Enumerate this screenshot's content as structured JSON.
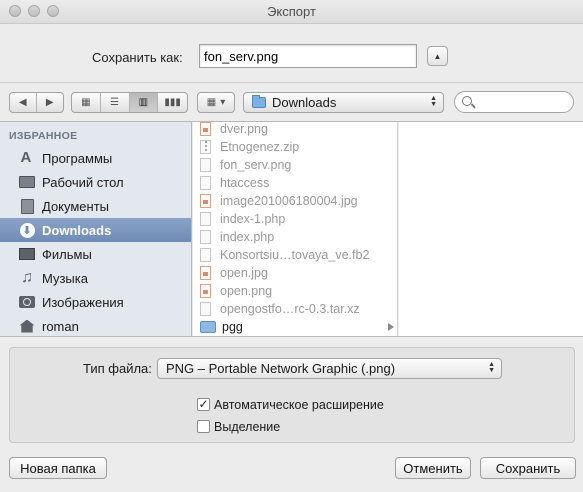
{
  "window": {
    "title": "Экспорт"
  },
  "save_as": {
    "label": "Сохранить как:",
    "value": "fon_serv.png"
  },
  "toolbar": {
    "location": "Downloads",
    "search_placeholder": ""
  },
  "sidebar": {
    "header": "ИЗБРАННОЕ",
    "items": [
      {
        "label": "Программы",
        "icon": "applications-icon",
        "selected": false
      },
      {
        "label": "Рабочий стол",
        "icon": "desktop-icon",
        "selected": false
      },
      {
        "label": "Документы",
        "icon": "documents-icon",
        "selected": false
      },
      {
        "label": "Downloads",
        "icon": "downloads-icon",
        "selected": true
      },
      {
        "label": "Фильмы",
        "icon": "movies-icon",
        "selected": false
      },
      {
        "label": "Музыка",
        "icon": "music-icon",
        "selected": false
      },
      {
        "label": "Изображения",
        "icon": "pictures-icon",
        "selected": false
      },
      {
        "label": "roman",
        "icon": "home-icon",
        "selected": false
      }
    ]
  },
  "files": [
    {
      "name": "dver.png",
      "kind": "img"
    },
    {
      "name": "Etnogenez.zip",
      "kind": "zip"
    },
    {
      "name": "fon_serv.png",
      "kind": "doc"
    },
    {
      "name": "htaccess",
      "kind": "doc"
    },
    {
      "name": "image201006180004.jpg",
      "kind": "img"
    },
    {
      "name": "index-1.php",
      "kind": "doc"
    },
    {
      "name": "index.php",
      "kind": "doc"
    },
    {
      "name": "Konsortsiu…tovaya_ve.fb2",
      "kind": "doc"
    },
    {
      "name": "open.jpg",
      "kind": "img"
    },
    {
      "name": "open.png",
      "kind": "img"
    },
    {
      "name": "opengostfo…rc-0.3.tar.xz",
      "kind": "doc"
    },
    {
      "name": "pgg",
      "kind": "folder"
    }
  ],
  "options": {
    "file_type_label": "Тип файла:",
    "file_type_value": "PNG – Portable Network Graphic (.png)",
    "auto_extension": {
      "label": "Автоматическое расширение",
      "checked": true
    },
    "selection": {
      "label": "Выделение",
      "checked": false
    }
  },
  "buttons": {
    "new_folder": "Новая папка",
    "cancel": "Отменить",
    "save": "Сохранить"
  },
  "colors": {
    "sidebar_selected": "#7c96bd",
    "sidebar_bg": "#e3e8ee"
  }
}
